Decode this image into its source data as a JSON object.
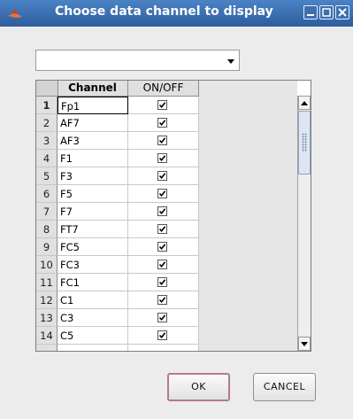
{
  "window": {
    "title": "Choose data channel to display",
    "app_icon": "matlab-icon",
    "controls": [
      "minimize-icon",
      "maximize-icon",
      "close-icon"
    ]
  },
  "dropdown": {
    "selected_value": ""
  },
  "table": {
    "columns": [
      "Channel",
      "ON/OFF"
    ],
    "rows": [
      {
        "num": "1",
        "channel": "Fp1",
        "on": true
      },
      {
        "num": "2",
        "channel": "AF7",
        "on": true
      },
      {
        "num": "3",
        "channel": "AF3",
        "on": true
      },
      {
        "num": "4",
        "channel": "F1",
        "on": true
      },
      {
        "num": "5",
        "channel": "F3",
        "on": true
      },
      {
        "num": "6",
        "channel": "F5",
        "on": true
      },
      {
        "num": "7",
        "channel": "F7",
        "on": true
      },
      {
        "num": "8",
        "channel": "FT7",
        "on": true
      },
      {
        "num": "9",
        "channel": "FC5",
        "on": true
      },
      {
        "num": "10",
        "channel": "FC3",
        "on": true
      },
      {
        "num": "11",
        "channel": "FC1",
        "on": true
      },
      {
        "num": "12",
        "channel": "C1",
        "on": true
      },
      {
        "num": "13",
        "channel": "C3",
        "on": true
      },
      {
        "num": "14",
        "channel": "C5",
        "on": true
      }
    ]
  },
  "buttons": {
    "ok_label": "OK",
    "cancel_label": "CANCEL"
  },
  "colors": {
    "titlebar": "#3a6fb5",
    "ok_focus_border": "#b27897"
  }
}
